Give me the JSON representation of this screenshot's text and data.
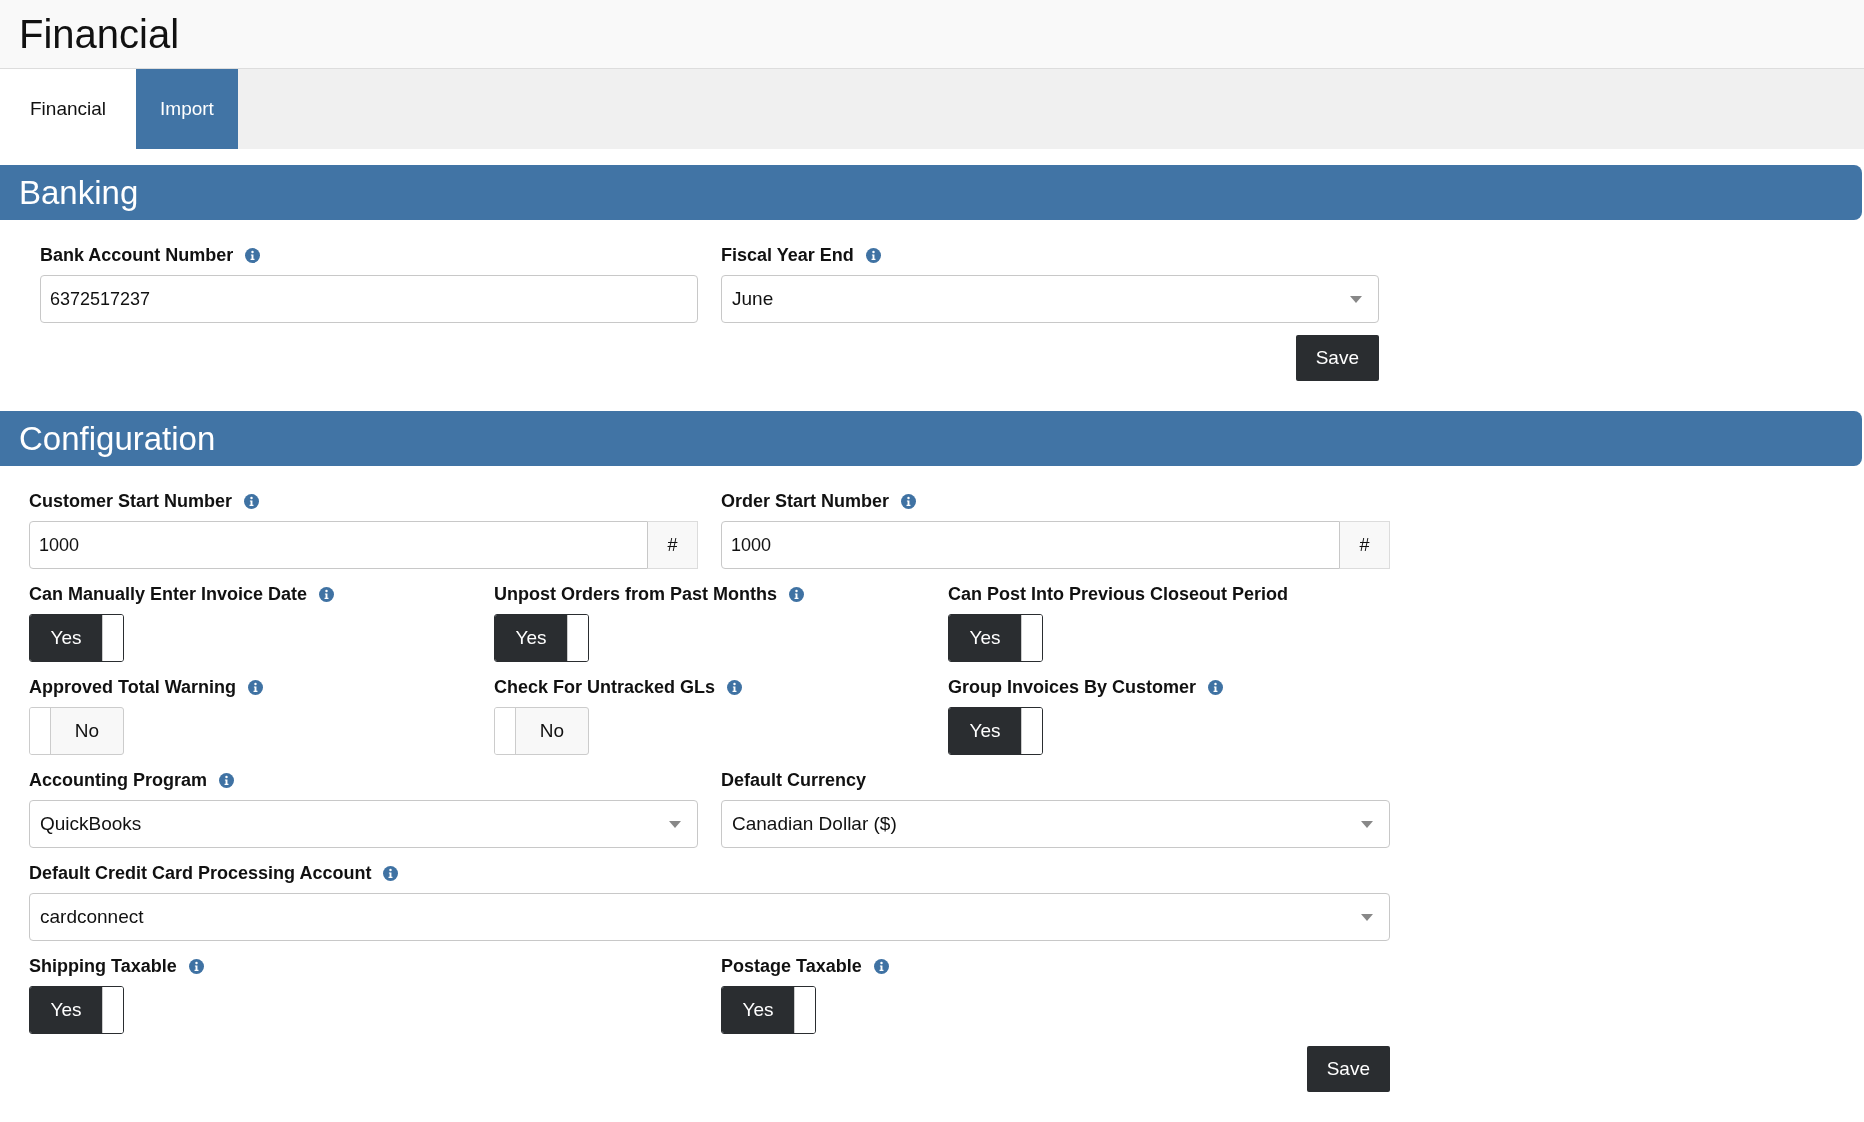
{
  "header": {
    "title": "Financial"
  },
  "tabs": [
    {
      "label": "Financial",
      "selected": false
    },
    {
      "label": "Import",
      "selected": true
    }
  ],
  "sections": [
    {
      "title": "Banking",
      "rows": [
        [
          {
            "kind": "text",
            "label": "Bank Account Number",
            "info": true,
            "value": "6372517237"
          },
          {
            "kind": "select",
            "label": "Fiscal Year End",
            "info": true,
            "value": "June"
          }
        ]
      ],
      "save": "Save"
    },
    {
      "title": "Configuration",
      "rows": [
        [
          {
            "kind": "addon",
            "label": "Customer Start Number",
            "info": true,
            "value": "1000",
            "addon": "#"
          },
          {
            "kind": "addon",
            "label": "Order Start Number",
            "info": true,
            "value": "1000",
            "addon": "#"
          }
        ],
        [
          {
            "kind": "toggle",
            "label": "Can Manually Enter Invoice Date",
            "info": true,
            "on": true,
            "value": "Yes"
          },
          {
            "kind": "toggle",
            "label": "Unpost Orders from Past Months",
            "info": true,
            "on": true,
            "value": "Yes"
          },
          {
            "kind": "toggle",
            "label": "Can Post Into Previous Closeout Period",
            "info": false,
            "on": true,
            "value": "Yes"
          }
        ],
        [
          {
            "kind": "toggle",
            "label": "Approved Total Warning",
            "info": true,
            "on": false,
            "value": "No"
          },
          {
            "kind": "toggle",
            "label": "Check For Untracked GLs",
            "info": true,
            "on": false,
            "value": "No"
          },
          {
            "kind": "toggle",
            "label": "Group Invoices By Customer",
            "info": true,
            "on": true,
            "value": "Yes"
          }
        ],
        [
          {
            "kind": "select",
            "label": "Accounting Program",
            "info": true,
            "value": "QuickBooks"
          },
          {
            "kind": "select",
            "label": "Default Currency",
            "info": false,
            "value": "Canadian Dollar ($)"
          }
        ],
        [
          {
            "kind": "select",
            "label": "Default Credit Card Processing Account",
            "info": true,
            "value": "cardconnect"
          }
        ],
        [
          {
            "kind": "toggle",
            "label": "Shipping Taxable",
            "info": true,
            "on": true,
            "value": "Yes"
          },
          {
            "kind": "toggle",
            "label": "Postage Taxable",
            "info": true,
            "on": true,
            "value": "Yes"
          }
        ]
      ],
      "save": "Save"
    }
  ]
}
